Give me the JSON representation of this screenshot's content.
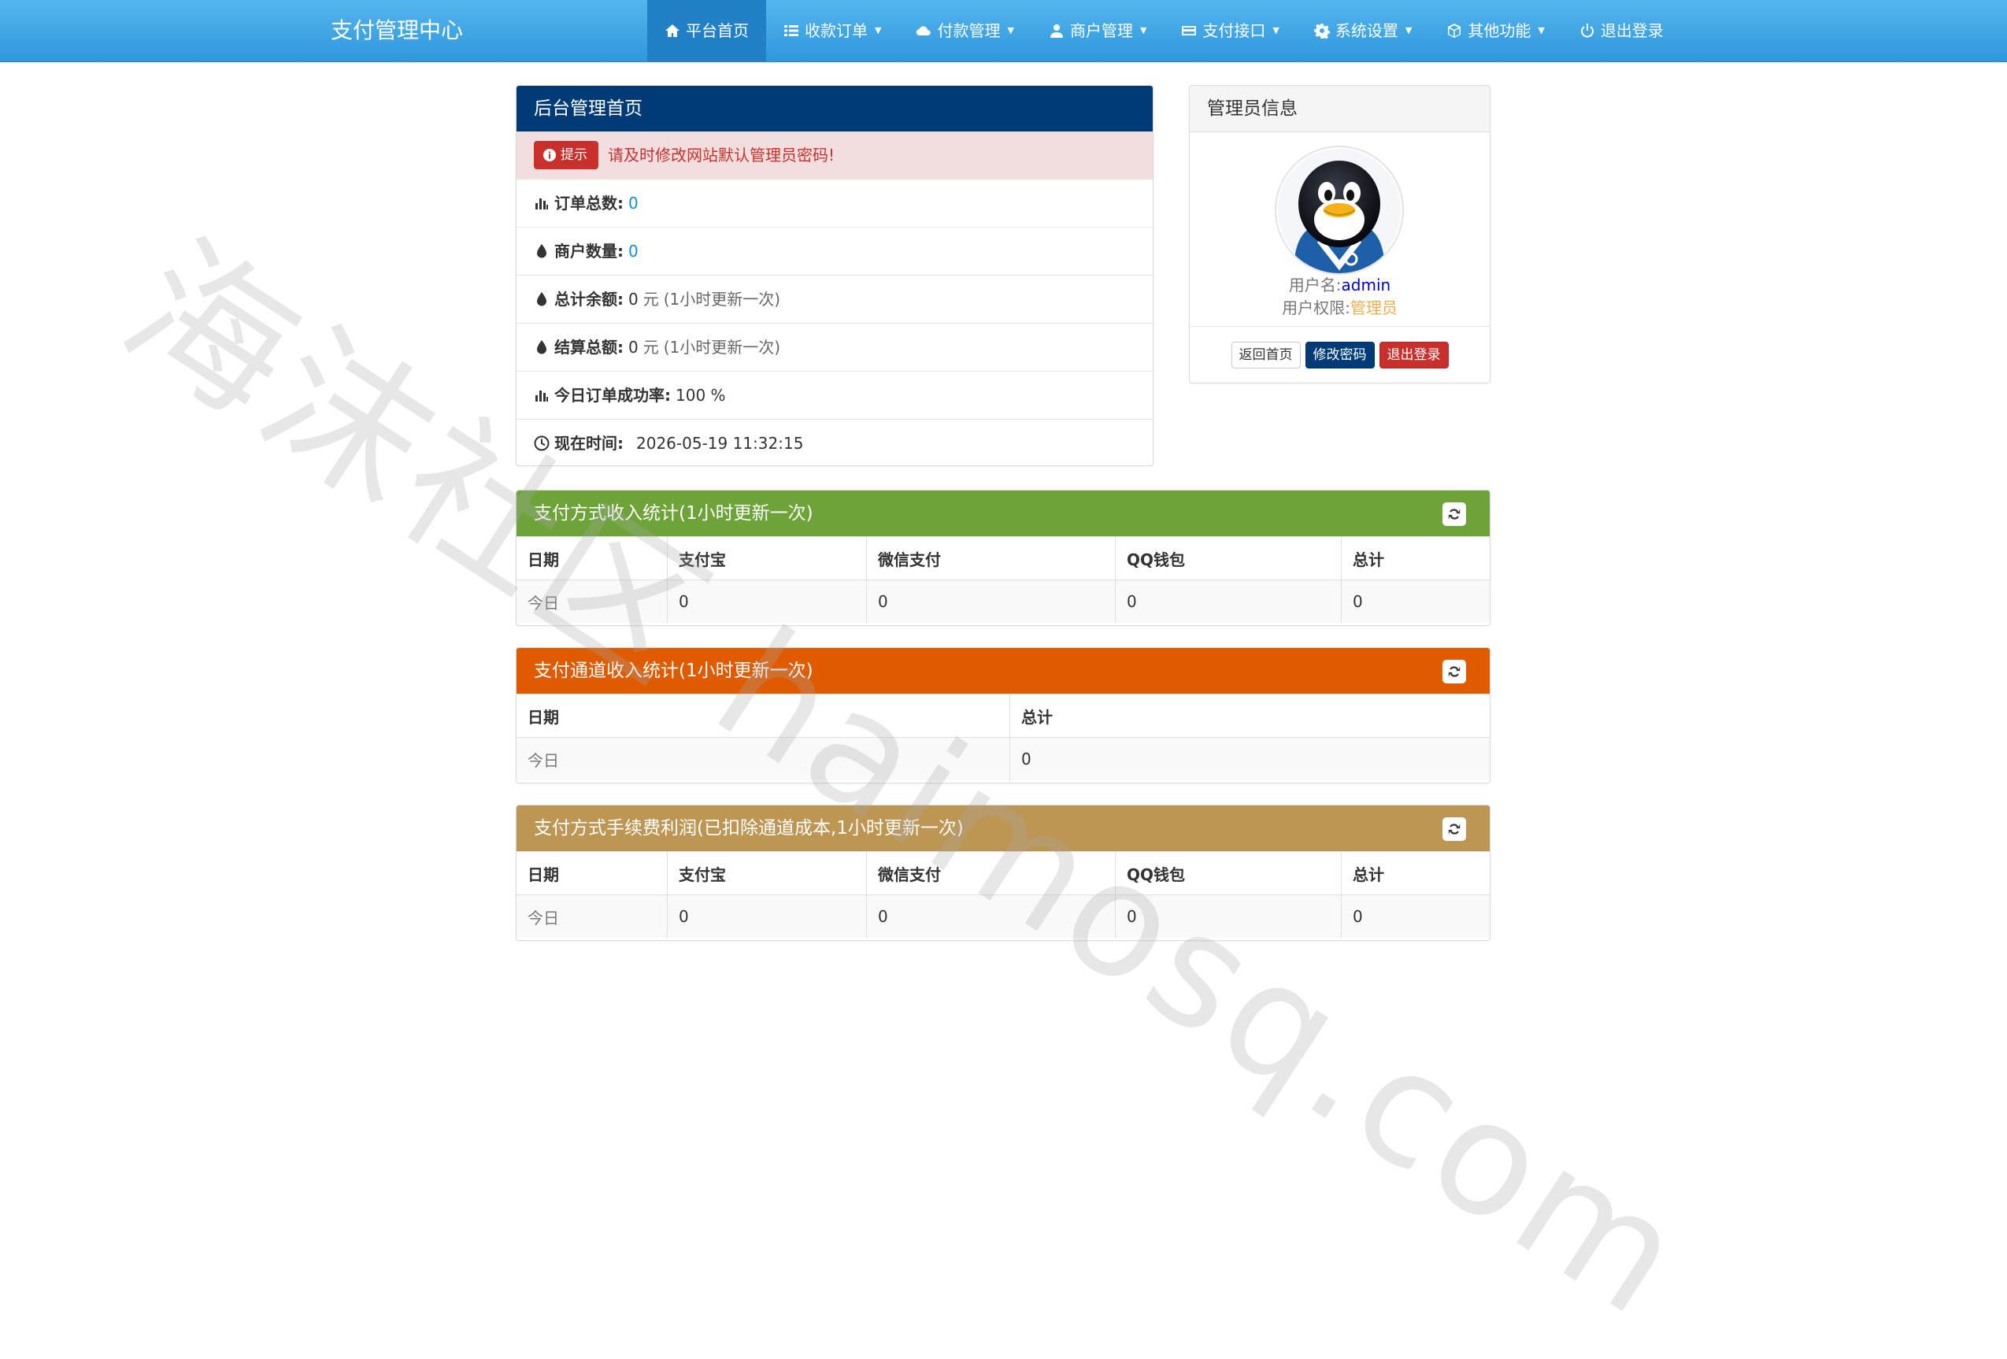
{
  "navbar": {
    "brand": "支付管理中心",
    "items": [
      {
        "label": "平台首页",
        "icon": "home-icon",
        "active": true,
        "dropdown": false
      },
      {
        "label": "收款订单",
        "icon": "list-icon",
        "dropdown": true
      },
      {
        "label": "付款管理",
        "icon": "cloud-icon",
        "dropdown": true
      },
      {
        "label": "商户管理",
        "icon": "user-icon",
        "dropdown": true
      },
      {
        "label": "支付接口",
        "icon": "credit-card-icon",
        "dropdown": true
      },
      {
        "label": "系统设置",
        "icon": "gear-icon",
        "dropdown": true
      },
      {
        "label": "其他功能",
        "icon": "cube-icon",
        "dropdown": true
      },
      {
        "label": "退出登录",
        "icon": "power-icon",
        "dropdown": false
      }
    ]
  },
  "home_panel": {
    "title": "后台管理首页",
    "tip_badge": "提示",
    "tip_text": "请及时修改网站默认管理员密码!",
    "rows": {
      "orders_label": "订单总数:",
      "orders_value": "0",
      "merchants_label": "商户数量:",
      "merchants_value": "0",
      "balance_label": "总计余额:",
      "balance_value": "0",
      "balance_unit": "元",
      "balance_note": "(1小时更新一次)",
      "settle_label": "结算总额:",
      "settle_value": "0",
      "settle_unit": "元",
      "settle_note": "(1小时更新一次)",
      "success_label": "今日订单成功率:",
      "success_value": "100 %",
      "time_label": "现在时间:",
      "time_value": "2026-05-19 11:32:15"
    }
  },
  "admin_panel": {
    "title": "管理员信息",
    "username_label": "用户名:",
    "username_value": "admin",
    "role_label": "用户权限:",
    "role_value": "管理员",
    "buttons": {
      "home": "返回首页",
      "change_password": "修改密码",
      "logout": "退出登录"
    }
  },
  "pay_method_stats": {
    "title": "支付方式收入统计(1小时更新一次)",
    "headers": [
      "日期",
      "支付宝",
      "微信支付",
      "QQ钱包",
      "总计"
    ],
    "rows": [
      [
        "今日",
        "0",
        "0",
        "0",
        "0"
      ]
    ]
  },
  "channel_stats": {
    "title": "支付通道收入统计(1小时更新一次)",
    "headers": [
      "日期",
      "总计"
    ],
    "rows": [
      [
        "今日",
        "0"
      ]
    ]
  },
  "fee_profit_stats": {
    "title": "支付方式手续费利润(已扣除通道成本,1小时更新一次)",
    "headers": [
      "日期",
      "支付宝",
      "微信支付",
      "QQ钱包",
      "总计"
    ],
    "rows": [
      [
        "今日",
        "0",
        "0",
        "0",
        "0"
      ]
    ]
  },
  "watermark": "海沫社区 haimosq.com",
  "colors": {
    "navbar": "#2f97de",
    "home_header": "#003b78",
    "pay_method_header": "#6ea33a",
    "channel_header": "#e05a00",
    "fee_header": "#be9654",
    "alert_bg": "#f2dede",
    "alert_text": "#c9302c"
  }
}
